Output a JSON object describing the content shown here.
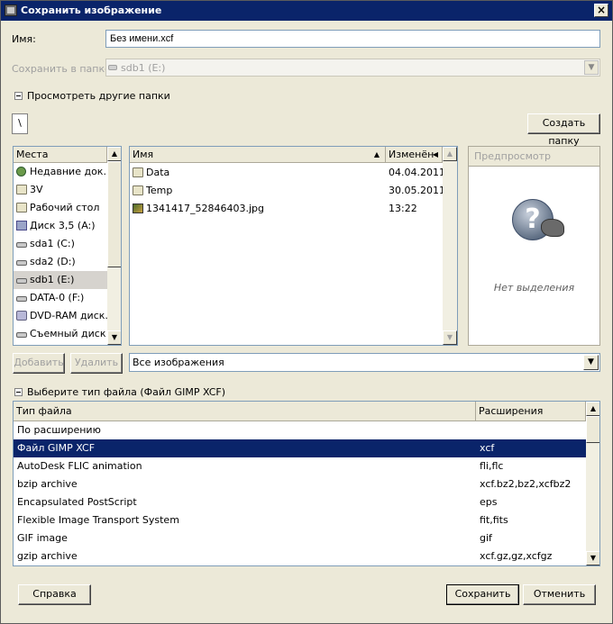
{
  "window": {
    "title": "Сохранить изображение"
  },
  "name_field": {
    "label": "Имя:",
    "value": "Без имени.xcf"
  },
  "save_in": {
    "label": "Сохранить в папке",
    "value": "sdb1 (E:)"
  },
  "browse_toggle_label": "Просмотреть другие папки",
  "path_segment": "\\",
  "create_folder_label": "Создать папку",
  "places": {
    "header": "Места",
    "items": [
      {
        "icon": "recent-icon",
        "label": "Недавние док..."
      },
      {
        "icon": "folder-icon",
        "label": "3V"
      },
      {
        "icon": "folder-icon",
        "label": "Рабочий стол"
      },
      {
        "icon": "floppy-icon",
        "label": "Диск 3,5 (A:)"
      },
      {
        "icon": "drive-icon",
        "label": "sda1 (C:)"
      },
      {
        "icon": "drive-icon",
        "label": "sda2 (D:)"
      },
      {
        "icon": "drive-icon",
        "label": "sdb1 (E:)"
      },
      {
        "icon": "drive-icon",
        "label": "DATA-0 (F:)"
      },
      {
        "icon": "dvd-icon",
        "label": "DVD-RAM диск..."
      },
      {
        "icon": "drive-icon",
        "label": "Съемный диск ..."
      }
    ],
    "selected_index": 6
  },
  "files": {
    "col_name": "Имя",
    "col_modified": "Изменён",
    "rows": [
      {
        "icon": "folder-icon",
        "name": "Data",
        "modified": "04.04.2011"
      },
      {
        "icon": "folder-icon",
        "name": "Temp",
        "modified": "30.05.2011"
      },
      {
        "icon": "image-icon",
        "name": "1341417_52846403.jpg",
        "modified": "13:22"
      }
    ]
  },
  "preview": {
    "header": "Предпросмотр",
    "empty_text": "Нет выделения"
  },
  "add_label": "Добавить",
  "remove_label": "Удалить",
  "filter_value": "Все изображения",
  "filetype_toggle_label": "Выберите тип файла (Файл GIMP XCF)",
  "filetypes": {
    "col_type": "Тип файла",
    "col_ext": "Расширения",
    "rows": [
      {
        "type": "По расширению",
        "ext": ""
      },
      {
        "type": "Файл GIMP XCF",
        "ext": "xcf"
      },
      {
        "type": "AutoDesk FLIC animation",
        "ext": "fli,flc"
      },
      {
        "type": "bzip archive",
        "ext": "xcf.bz2,bz2,xcfbz2"
      },
      {
        "type": "Encapsulated PostScript",
        "ext": "eps"
      },
      {
        "type": "Flexible Image Transport System",
        "ext": "fit,fits"
      },
      {
        "type": "GIF image",
        "ext": "gif"
      },
      {
        "type": "gzip archive",
        "ext": "xcf.gz,gz,xcfgz"
      }
    ],
    "selected_index": 1
  },
  "help_label": "Справка",
  "save_label": "Сохранить",
  "cancel_label": "Отменить"
}
